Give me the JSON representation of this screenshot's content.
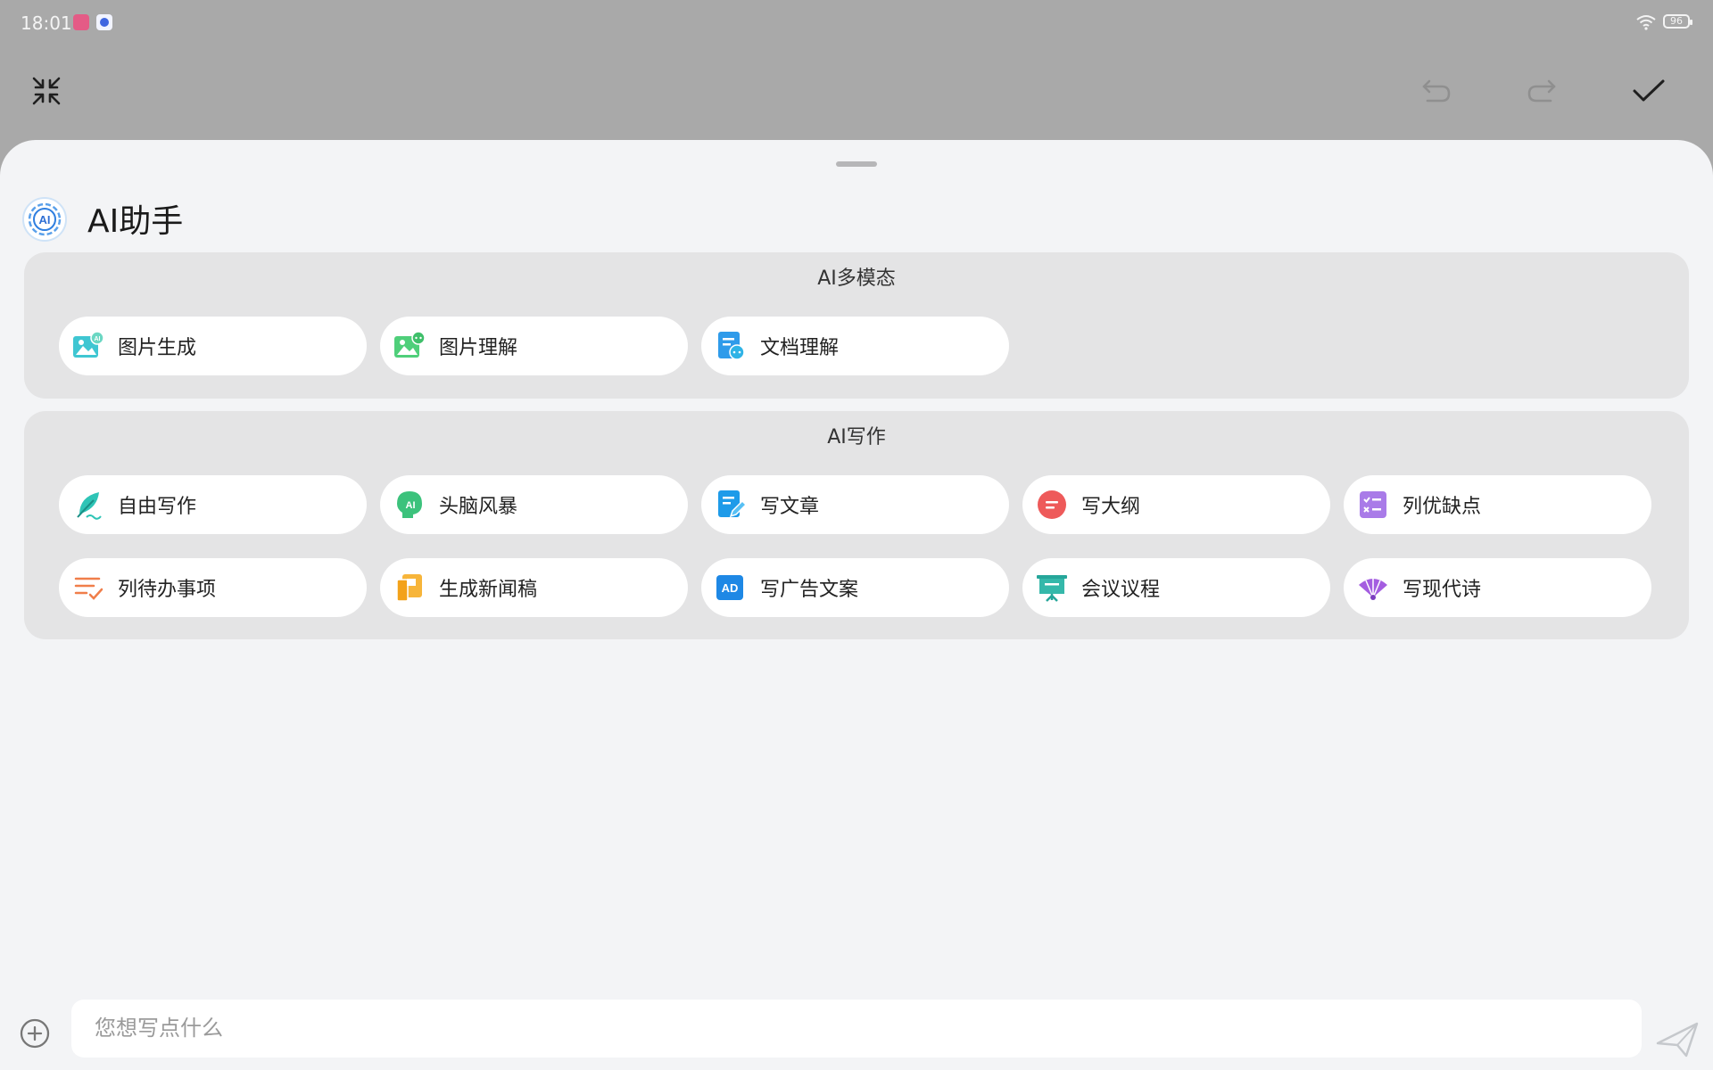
{
  "status": {
    "time": "18:01",
    "battery": "96"
  },
  "sheet": {
    "title": "AI助手"
  },
  "multimodal": {
    "title": "AI多模态",
    "items": [
      {
        "label": "图片生成",
        "icon": "image-ai-icon"
      },
      {
        "label": "图片理解",
        "icon": "image-understand-icon"
      },
      {
        "label": "文档理解",
        "icon": "document-understand-icon"
      }
    ]
  },
  "writing": {
    "title": "AI写作",
    "items": [
      {
        "label": "自由写作",
        "icon": "feather-icon"
      },
      {
        "label": "头脑风暴",
        "icon": "brain-ai-icon"
      },
      {
        "label": "写文章",
        "icon": "article-edit-icon"
      },
      {
        "label": "写大纲",
        "icon": "outline-icon"
      },
      {
        "label": "列优缺点",
        "icon": "pros-cons-icon"
      },
      {
        "label": "列待办事项",
        "icon": "todo-list-icon"
      },
      {
        "label": "生成新闻稿",
        "icon": "news-icon"
      },
      {
        "label": "写广告文案",
        "icon": "ad-icon"
      },
      {
        "label": "会议议程",
        "icon": "meeting-board-icon"
      },
      {
        "label": "写现代诗",
        "icon": "fan-icon"
      }
    ]
  },
  "composer": {
    "placeholder": "您想写点什么"
  },
  "colors": {
    "accent": "#2f9bea",
    "sheet_bg": "#f3f4f6",
    "card_bg": "#e4e4e5"
  }
}
